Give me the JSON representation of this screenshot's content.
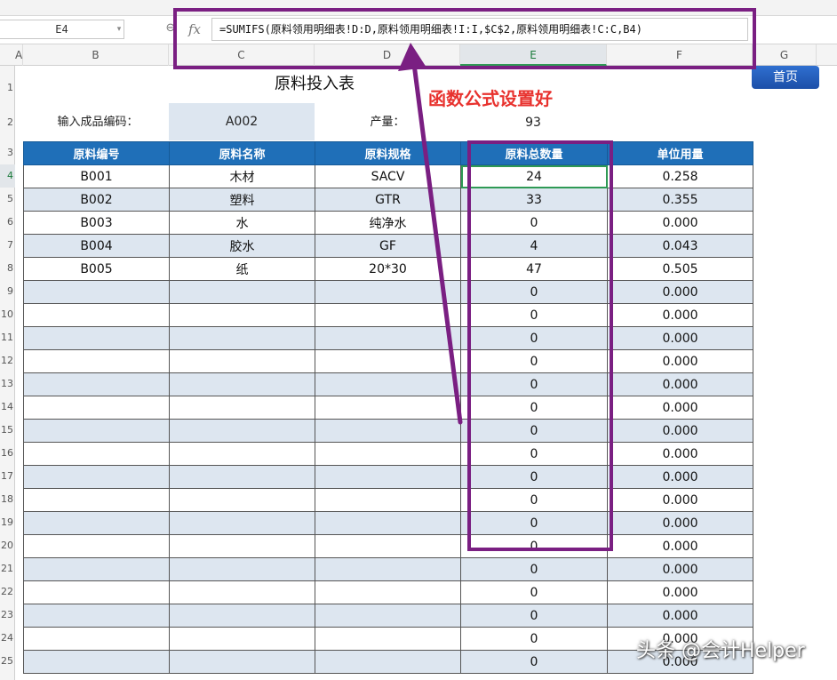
{
  "formula_bar": {
    "name_box": "E4",
    "fx_label": "fx",
    "formula": "=SUMIFS(原料领用明细表!D:D,原料领用明细表!I:I,$C$2,原料领用明细表!C:C,B4)"
  },
  "columns": [
    "A",
    "B",
    "C",
    "D",
    "E",
    "F",
    "G"
  ],
  "row_numbers": [
    "1",
    "2",
    "3",
    "4",
    "5",
    "6",
    "7",
    "8",
    "9",
    "10",
    "11",
    "12",
    "13",
    "14",
    "15",
    "16",
    "17",
    "18",
    "19",
    "20",
    "21",
    "22",
    "23",
    "24",
    "25"
  ],
  "active_cell": {
    "column": "E",
    "row": "4"
  },
  "sheet": {
    "title": "原料投入表",
    "home_button": "首页",
    "input_label": "输入成品编码：",
    "input_value": "A002",
    "output_label": "产量：",
    "output_value": "93"
  },
  "table": {
    "headers": [
      "原料编号",
      "原料名称",
      "原料规格",
      "原料总数量",
      "单位用量"
    ],
    "rows": [
      [
        "B001",
        "木材",
        "SACV",
        "24",
        "0.258"
      ],
      [
        "B002",
        "塑料",
        "GTR",
        "33",
        "0.355"
      ],
      [
        "B003",
        "水",
        "纯净水",
        "0",
        "0.000"
      ],
      [
        "B004",
        "胶水",
        "GF",
        "4",
        "0.043"
      ],
      [
        "B005",
        "纸",
        "20*30",
        "47",
        "0.505"
      ],
      [
        "",
        "",
        "",
        "0",
        "0.000"
      ],
      [
        "",
        "",
        "",
        "0",
        "0.000"
      ],
      [
        "",
        "",
        "",
        "0",
        "0.000"
      ],
      [
        "",
        "",
        "",
        "0",
        "0.000"
      ],
      [
        "",
        "",
        "",
        "0",
        "0.000"
      ],
      [
        "",
        "",
        "",
        "0",
        "0.000"
      ],
      [
        "",
        "",
        "",
        "0",
        "0.000"
      ],
      [
        "",
        "",
        "",
        "0",
        "0.000"
      ],
      [
        "",
        "",
        "",
        "0",
        "0.000"
      ],
      [
        "",
        "",
        "",
        "0",
        "0.000"
      ],
      [
        "",
        "",
        "",
        "0",
        "0.000"
      ],
      [
        "",
        "",
        "",
        "0",
        "0.000"
      ],
      [
        "",
        "",
        "",
        "0",
        "0.000"
      ],
      [
        "",
        "",
        "",
        "0",
        "0.000"
      ],
      [
        "",
        "",
        "",
        "0",
        "0.000"
      ],
      [
        "",
        "",
        "",
        "0",
        "0.000"
      ],
      [
        "",
        "",
        "",
        "0",
        "0.000"
      ]
    ]
  },
  "annotation": {
    "text": "函数公式设置好",
    "color": "#e8322e",
    "box_color": "#7a1f82"
  },
  "watermark": "头条 @会计Helper"
}
